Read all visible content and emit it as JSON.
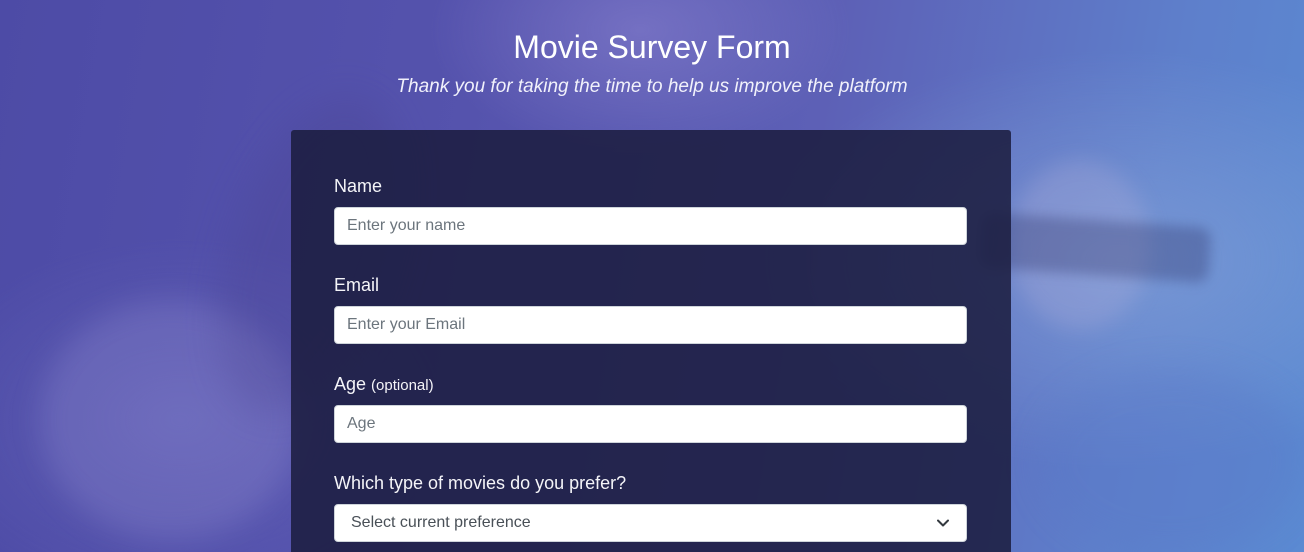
{
  "header": {
    "title": "Movie Survey Form",
    "subtitle": "Thank you for taking the time to help us improve the platform"
  },
  "form": {
    "name": {
      "label": "Name",
      "placeholder": "Enter your name",
      "value": ""
    },
    "email": {
      "label": "Email",
      "placeholder": "Enter your Email",
      "value": ""
    },
    "age": {
      "label": "Age",
      "optional_label": "(optional)",
      "placeholder": "Age",
      "value": ""
    },
    "preference": {
      "label": "Which type of movies do you prefer?",
      "selected": "Select current preference",
      "icon": "chevron-down-icon"
    }
  },
  "colors": {
    "background_left": "#4d4ba6",
    "background_right": "#5b8ad2",
    "card": "#1b1c3e",
    "input_border": "#ced4da",
    "placeholder": "#6c757d"
  }
}
